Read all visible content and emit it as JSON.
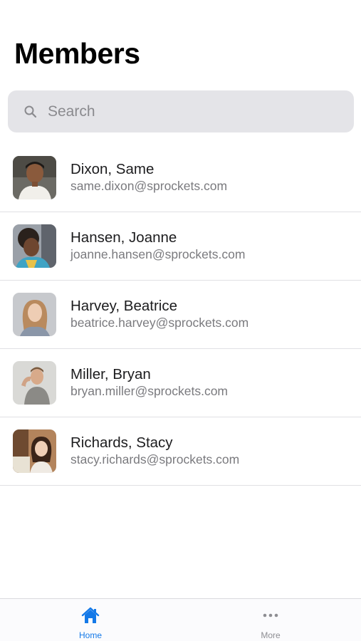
{
  "page": {
    "title": "Members"
  },
  "search": {
    "placeholder": "Search",
    "value": ""
  },
  "members": [
    {
      "name": "Dixon, Same",
      "email": "same.dixon@sprockets.com"
    },
    {
      "name": "Hansen, Joanne",
      "email": "joanne.hansen@sprockets.com"
    },
    {
      "name": "Harvey, Beatrice",
      "email": "beatrice.harvey@sprockets.com"
    },
    {
      "name": "Miller, Bryan",
      "email": "bryan.miller@sprockets.com"
    },
    {
      "name": "Richards, Stacy",
      "email": "stacy.richards@sprockets.com"
    }
  ],
  "tab_bar": {
    "tabs": [
      {
        "label": "Home",
        "icon": "house-icon",
        "active": true
      },
      {
        "label": "More",
        "icon": "ellipsis-icon",
        "active": false
      }
    ]
  },
  "colors": {
    "accent": "#1479e8",
    "inactive": "#8e8e93",
    "search_bg": "#e4e4e8"
  }
}
